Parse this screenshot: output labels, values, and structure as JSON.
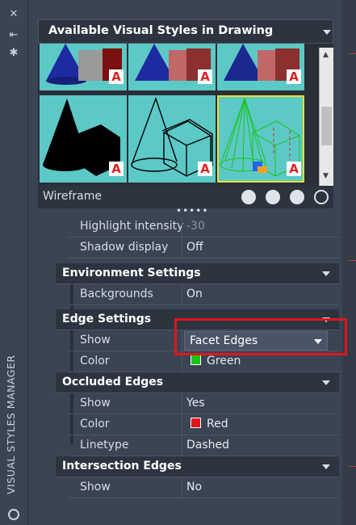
{
  "palette": {
    "title": "VISUAL STYLES MANAGER"
  },
  "gallery": {
    "title": "Available Visual Styles in Drawing",
    "current_style": "Wireframe",
    "badge": "A"
  },
  "properties": {
    "lighting_rows": [
      {
        "label": "Highlight intensity",
        "value": "-30"
      },
      {
        "label": "Shadow display",
        "value": "Off"
      }
    ],
    "environment": {
      "title": "Environment Settings",
      "backgrounds_label": "Backgrounds",
      "backgrounds_value": "On"
    },
    "edge": {
      "title": "Edge Settings",
      "show_label": "Show",
      "show_value": "Facet Edges",
      "color_label": "Color",
      "color_value": "Green",
      "color_hex": "#19c519"
    },
    "occluded": {
      "title": "Occluded Edges",
      "show_label": "Show",
      "show_value": "Yes",
      "color_label": "Color",
      "color_value": "Red",
      "color_hex": "#e0161c",
      "linetype_label": "Linetype",
      "linetype_value": "Dashed"
    },
    "intersection": {
      "title": "Intersection Edges",
      "show_label": "Show",
      "show_value": "No"
    }
  },
  "colors": {
    "highlight_border": "#e0161c",
    "selected_thumb_border": "#e7e032"
  }
}
